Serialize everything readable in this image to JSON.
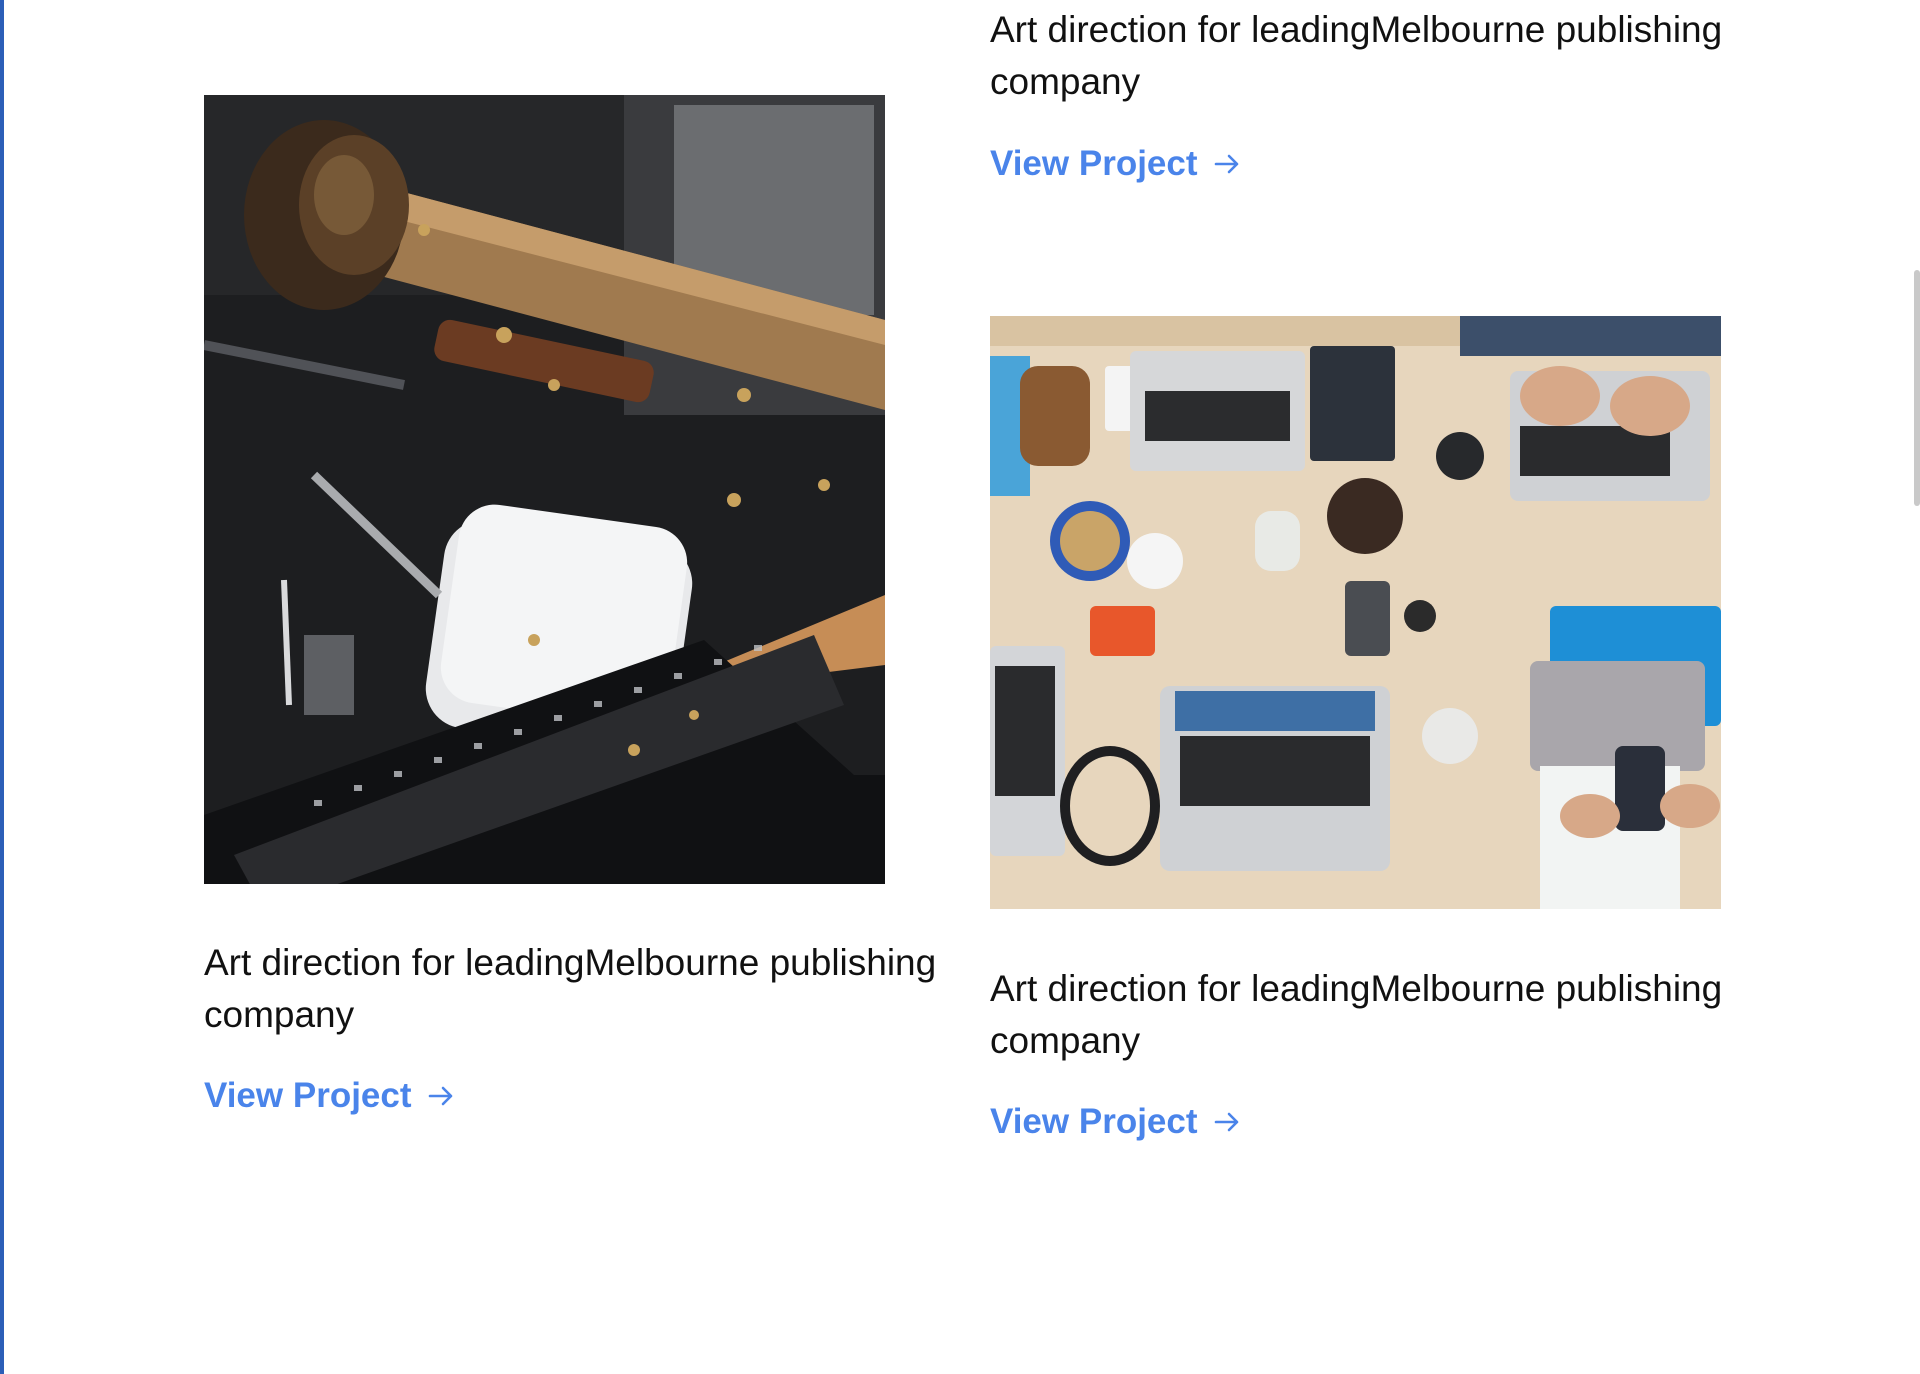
{
  "projects": [
    {
      "title": "Art direction for leadingMelbourne publishing company",
      "link_label": "View Project",
      "link_icon": "arrow-right-icon"
    },
    {
      "title": "Art direction for leadingMelbourne publishing company",
      "link_label": "View Project",
      "link_icon": "arrow-right-icon",
      "image": "leather-craft-tools-photo"
    },
    {
      "title": "Art direction for leadingMelbourne publishing company",
      "link_label": "View Project",
      "link_icon": "arrow-right-icon",
      "image": "team-laptops-desk-photo"
    }
  ],
  "colors": {
    "link": "#4a84ea",
    "text": "#111111",
    "left_rule": "#2c5fb8"
  }
}
